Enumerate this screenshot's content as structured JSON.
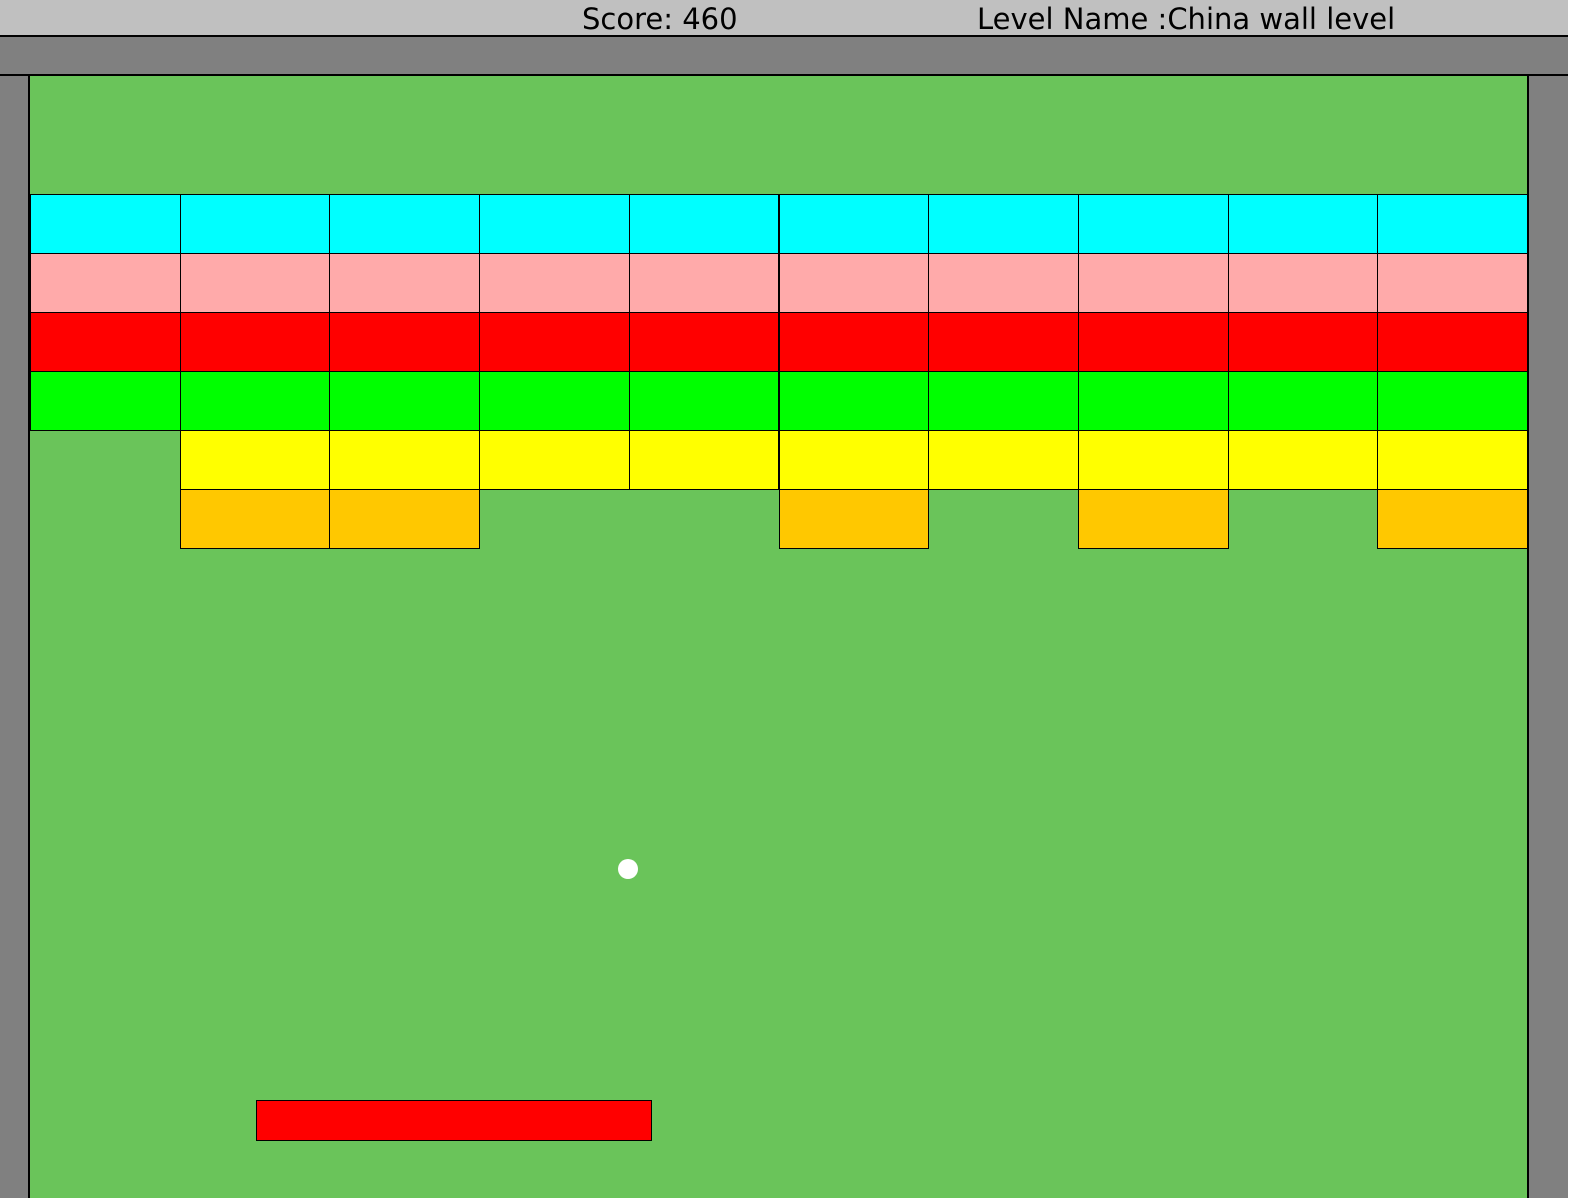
{
  "hud": {
    "score_text": "Score: 460",
    "level_text": "Level Name :China wall level"
  },
  "colors": {
    "background": "#6ac45a",
    "walls": "#808080",
    "hud_bar": "#c0c0c0",
    "paddle": "#ff0000",
    "ball": "#ffffff"
  },
  "bricks": {
    "columns": 10,
    "row_colors": [
      "#00ffff",
      "#ffaaaa",
      "#ff0000",
      "#00ff00",
      "#ffff00",
      "#ffc800"
    ],
    "rows": [
      [
        1,
        1,
        1,
        1,
        1,
        1,
        1,
        1,
        1,
        1
      ],
      [
        1,
        1,
        1,
        1,
        1,
        1,
        1,
        1,
        1,
        1
      ],
      [
        1,
        1,
        1,
        1,
        1,
        1,
        1,
        1,
        1,
        1
      ],
      [
        1,
        1,
        1,
        1,
        1,
        1,
        1,
        1,
        1,
        1
      ],
      [
        0,
        1,
        1,
        1,
        1,
        1,
        1,
        1,
        1,
        1
      ],
      [
        0,
        1,
        1,
        0,
        0,
        1,
        0,
        1,
        0,
        1
      ]
    ]
  }
}
